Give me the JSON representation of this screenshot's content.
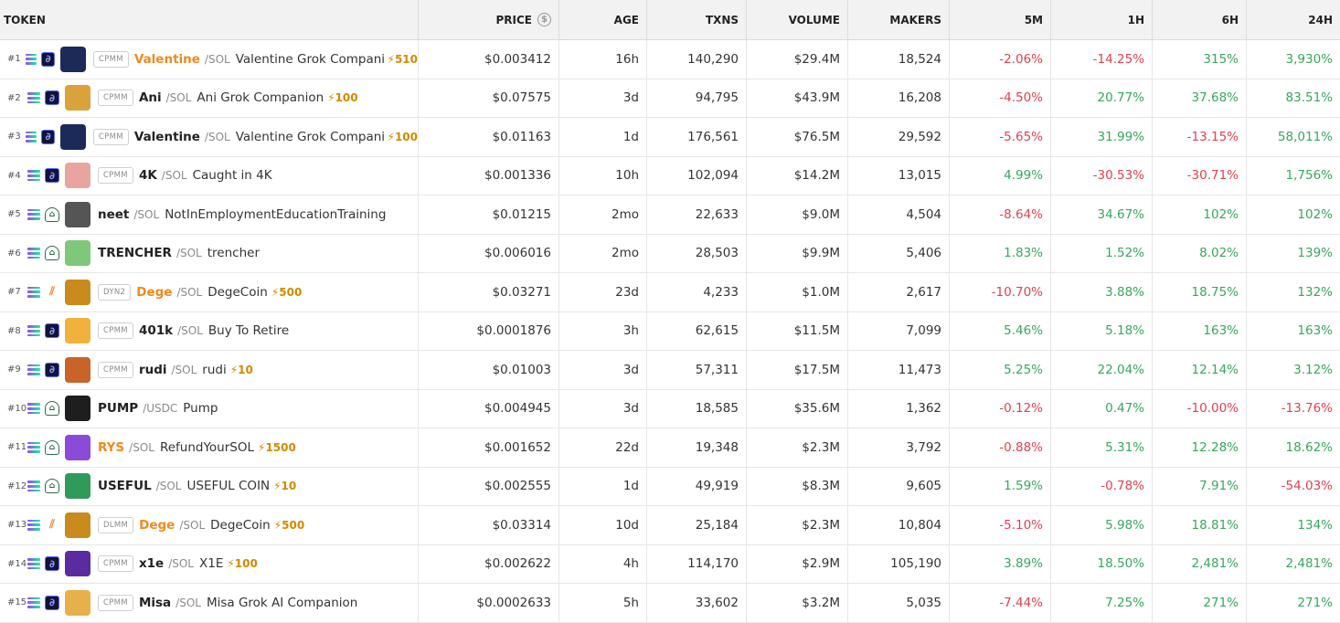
{
  "header": {
    "token": "TOKEN",
    "price": "PRICE",
    "price_icon": "dollar-circle-icon",
    "age": "AGE",
    "txns": "TXNS",
    "volume": "VOLUME",
    "makers": "MAKERS",
    "m5": "5M",
    "h1": "1H",
    "h6": "6H",
    "h24": "24H"
  },
  "colors": {
    "negative": "#e0424f",
    "positive": "#3aa55f",
    "boost": "#d18a00",
    "highlight_symbol": "#f08a1c"
  },
  "rows": [
    {
      "rank": "#1",
      "dex": "raydium",
      "badge": "CPMM",
      "symbol": "Valentine",
      "orange": true,
      "quote": "/SOL",
      "name": "Valentine Grok Companion",
      "boost": "⚡510",
      "price": "$0.003412",
      "age": "16h",
      "txns": "140,290",
      "volume": "$29.4M",
      "makers": "18,524",
      "m5": "-2.06%",
      "h1": "-14.25%",
      "h6": "315%",
      "h24": "3,930%",
      "avatar_color": "#1c2a5a"
    },
    {
      "rank": "#2",
      "dex": "raydium",
      "badge": "CPMM",
      "symbol": "Ani",
      "orange": false,
      "quote": "/SOL",
      "name": "Ani Grok Companion",
      "boost": "⚡100",
      "price": "$0.07575",
      "age": "3d",
      "txns": "94,795",
      "volume": "$43.9M",
      "makers": "16,208",
      "m5": "-4.50%",
      "h1": "20.77%",
      "h6": "37.68%",
      "h24": "83.51%",
      "avatar_color": "#d9a23a"
    },
    {
      "rank": "#3",
      "dex": "raydium",
      "badge": "CPMM",
      "symbol": "Valentine",
      "orange": false,
      "quote": "/SOL",
      "name": "Valentine Grok Companion",
      "boost": "⚡100",
      "price": "$0.01163",
      "age": "1d",
      "txns": "176,561",
      "volume": "$76.5M",
      "makers": "29,592",
      "m5": "-5.65%",
      "h1": "31.99%",
      "h6": "-13.15%",
      "h24": "58,011%",
      "avatar_color": "#1c2a5a"
    },
    {
      "rank": "#4",
      "dex": "raydium",
      "badge": "CPMM",
      "symbol": "4K",
      "orange": false,
      "quote": "/SOL",
      "name": "Caught in 4K",
      "boost": "",
      "price": "$0.001336",
      "age": "10h",
      "txns": "102,094",
      "volume": "$14.2M",
      "makers": "13,015",
      "m5": "4.99%",
      "h1": "-30.53%",
      "h6": "-30.71%",
      "h24": "1,756%",
      "avatar_color": "#e8a5a0"
    },
    {
      "rank": "#5",
      "dex": "pumpswap",
      "badge": "",
      "symbol": "neet",
      "orange": false,
      "quote": "/SOL",
      "name": "NotInEmploymentEducationTraining",
      "boost": "",
      "price": "$0.01215",
      "age": "2mo",
      "txns": "22,633",
      "volume": "$9.0M",
      "makers": "4,504",
      "m5": "-8.64%",
      "h1": "34.67%",
      "h6": "102%",
      "h24": "102%",
      "avatar_color": "#555555"
    },
    {
      "rank": "#6",
      "dex": "pumpswap",
      "badge": "",
      "symbol": "TRENCHER",
      "orange": false,
      "quote": "/SOL",
      "name": "trencher",
      "boost": "",
      "price": "$0.006016",
      "age": "2mo",
      "txns": "28,503",
      "volume": "$9.9M",
      "makers": "5,406",
      "m5": "1.83%",
      "h1": "1.52%",
      "h6": "8.02%",
      "h24": "139%",
      "avatar_color": "#7ec87a"
    },
    {
      "rank": "#7",
      "dex": "meteora",
      "badge": "DYN2",
      "symbol": "Dege",
      "orange": true,
      "quote": "/SOL",
      "name": "DegeCoin",
      "boost": "⚡500",
      "price": "$0.03271",
      "age": "23d",
      "txns": "4,233",
      "volume": "$1.0M",
      "makers": "2,617",
      "m5": "-10.70%",
      "h1": "3.88%",
      "h6": "18.75%",
      "h24": "132%",
      "avatar_color": "#c98a1e"
    },
    {
      "rank": "#8",
      "dex": "raydium",
      "badge": "CPMM",
      "symbol": "401k",
      "orange": false,
      "quote": "/SOL",
      "name": "Buy To Retire",
      "boost": "",
      "price": "$0.0001876",
      "age": "3h",
      "txns": "62,615",
      "volume": "$11.5M",
      "makers": "7,099",
      "m5": "5.46%",
      "h1": "5.18%",
      "h6": "163%",
      "h24": "163%",
      "avatar_color": "#f0b23c"
    },
    {
      "rank": "#9",
      "dex": "raydium",
      "badge": "CPMM",
      "symbol": "rudi",
      "orange": false,
      "quote": "/SOL",
      "name": "rudi",
      "boost": "⚡10",
      "price": "$0.01003",
      "age": "3d",
      "txns": "57,311",
      "volume": "$17.5M",
      "makers": "11,473",
      "m5": "5.25%",
      "h1": "22.04%",
      "h6": "12.14%",
      "h24": "3.12%",
      "avatar_color": "#c8642a"
    },
    {
      "rank": "#10",
      "dex": "pumpswap",
      "badge": "",
      "symbol": "PUMP",
      "orange": false,
      "quote": "/USDC",
      "name": "Pump",
      "boost": "",
      "price": "$0.004945",
      "age": "3d",
      "txns": "18,585",
      "volume": "$35.6M",
      "makers": "1,362",
      "m5": "-0.12%",
      "h1": "0.47%",
      "h6": "-10.00%",
      "h24": "-13.76%",
      "avatar_color": "#1e1e1e"
    },
    {
      "rank": "#11",
      "dex": "pumpswap",
      "badge": "",
      "symbol": "RYS",
      "orange": true,
      "quote": "/SOL",
      "name": "RefundYourSOL",
      "boost": "⚡1500",
      "price": "$0.001652",
      "age": "22d",
      "txns": "19,348",
      "volume": "$2.3M",
      "makers": "3,792",
      "m5": "-0.88%",
      "h1": "5.31%",
      "h6": "12.28%",
      "h24": "18.62%",
      "avatar_color": "#8a4cd8"
    },
    {
      "rank": "#12",
      "dex": "pumpswap",
      "badge": "",
      "symbol": "USEFUL",
      "orange": false,
      "quote": "/SOL",
      "name": "USEFUL COIN",
      "boost": "⚡10",
      "price": "$0.002555",
      "age": "1d",
      "txns": "49,919",
      "volume": "$8.3M",
      "makers": "9,605",
      "m5": "1.59%",
      "h1": "-0.78%",
      "h6": "7.91%",
      "h24": "-54.03%",
      "avatar_color": "#2f9a5a"
    },
    {
      "rank": "#13",
      "dex": "meteora",
      "badge": "DLMM",
      "symbol": "Dege",
      "orange": true,
      "quote": "/SOL",
      "name": "DegeCoin",
      "boost": "⚡500",
      "price": "$0.03314",
      "age": "10d",
      "txns": "25,184",
      "volume": "$2.3M",
      "makers": "10,804",
      "m5": "-5.10%",
      "h1": "5.98%",
      "h6": "18.81%",
      "h24": "134%",
      "avatar_color": "#c98a1e"
    },
    {
      "rank": "#14",
      "dex": "raydium",
      "badge": "CPMM",
      "symbol": "x1e",
      "orange": false,
      "quote": "/SOL",
      "name": "X1E",
      "boost": "⚡100",
      "price": "$0.002622",
      "age": "4h",
      "txns": "114,170",
      "volume": "$2.9M",
      "makers": "105,190",
      "m5": "3.89%",
      "h1": "18.50%",
      "h6": "2,481%",
      "h24": "2,481%",
      "avatar_color": "#5a2ca0"
    },
    {
      "rank": "#15",
      "dex": "raydium",
      "badge": "CPMM",
      "symbol": "Misa",
      "orange": false,
      "quote": "/SOL",
      "name": "Misa Grok AI Companion",
      "boost": "",
      "price": "$0.0002633",
      "age": "5h",
      "txns": "33,602",
      "volume": "$3.2M",
      "makers": "5,035",
      "m5": "-7.44%",
      "h1": "7.25%",
      "h6": "271%",
      "h24": "271%",
      "avatar_color": "#e8b04a"
    }
  ]
}
